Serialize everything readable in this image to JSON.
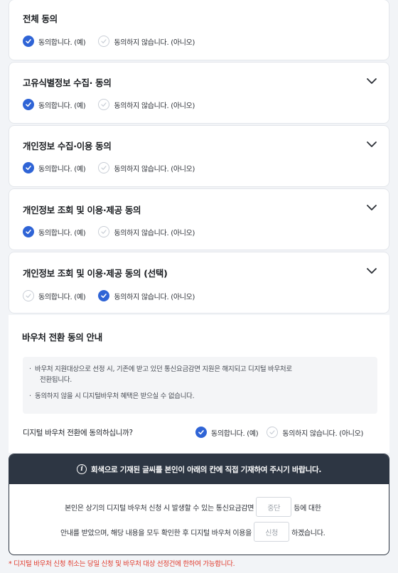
{
  "sections": [
    {
      "title": "전체 동의",
      "agree_label": "동의합니다. (예)",
      "disagree_label": "동의하지 않습니다. (아니오)",
      "selected": "agree",
      "expandable": false
    },
    {
      "title": "고유식별정보 수집· 동의",
      "agree_label": "동의합니다. (예)",
      "disagree_label": "동의하지 않습니다. (아니오)",
      "selected": "agree",
      "expandable": true
    },
    {
      "title": "개인정보 수집·이용 동의",
      "agree_label": "동의합니다. (예)",
      "disagree_label": "동의하지 않습니다. (아니오)",
      "selected": "agree",
      "expandable": true
    },
    {
      "title": "개인정보 조회 및 이용·제공 동의",
      "agree_label": "동의합니다. (예)",
      "disagree_label": "동의하지 않습니다. (아니오)",
      "selected": "agree",
      "expandable": true
    },
    {
      "title": "개인정보 조회 및 이용·제공 동의 (선택)",
      "agree_label": "동의합니다. (예)",
      "disagree_label": "동의하지 않습니다. (아니오)",
      "selected": "disagree",
      "expandable": true
    }
  ],
  "voucher": {
    "title": "바우처 전환 동의 안내",
    "notice_1a": "바우처 지원대상으로 선정 시, 기존에 받고 있던 통신요금감면 지원은 해지되고 디지털 바우처로",
    "notice_1b": "전환됩니다.",
    "notice_2": "동의하지 않을 시 디지털바우처 혜택은 받으실 수 없습니다.",
    "bullet": "·",
    "question": "디지털 바우처 전환에 동의하십니까?",
    "agree_label": "동의합니다. (예)",
    "disagree_label": "동의하지 않습니다. (아니오)",
    "selected": "agree"
  },
  "confirm": {
    "header": "회색으로 기재된 글씨를 본인이 아래의 칸에 직접 기재하여 주시기 바랍니다.",
    "info_glyph": "i",
    "line1_before": "본인은 상기의 디지털 바우처 신청 시 발생할 수 있는 통신요금감면",
    "line1_box": "중단",
    "line1_after": "등에 대한",
    "line2_before": "안내를 받았으며, 해당 내용을 모두 확인한 후 디지털 바우처 이용을",
    "line2_box": "신청",
    "line2_after": "하겠습니다."
  },
  "footnote": "* 디지털 바우처 신청 취소는 당일 신청 및 바우처 대상 선정건에 한하여 가능합니다.",
  "colors": {
    "accent": "#2f64d6",
    "dark_header": "#2d3643",
    "warning": "#e0392b"
  }
}
